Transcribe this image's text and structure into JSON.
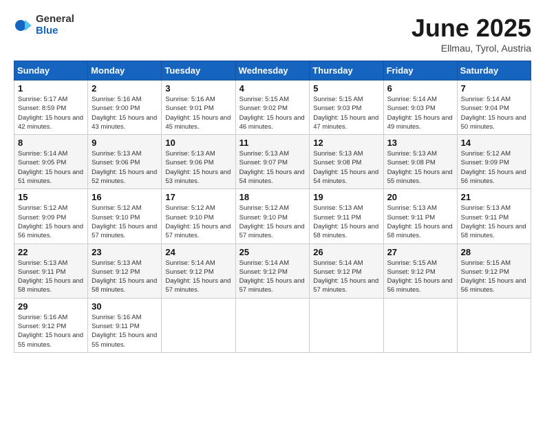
{
  "header": {
    "logo_text_general": "General",
    "logo_text_blue": "Blue",
    "month_title": "June 2025",
    "location": "Ellmau, Tyrol, Austria"
  },
  "calendar": {
    "headers": [
      "Sunday",
      "Monday",
      "Tuesday",
      "Wednesday",
      "Thursday",
      "Friday",
      "Saturday"
    ],
    "weeks": [
      [
        null,
        null,
        null,
        null,
        null,
        null,
        null
      ]
    ],
    "days": {
      "1": {
        "sunrise": "5:17 AM",
        "sunset": "8:59 PM",
        "daylight": "15 hours and 42 minutes."
      },
      "2": {
        "sunrise": "5:16 AM",
        "sunset": "9:00 PM",
        "daylight": "15 hours and 43 minutes."
      },
      "3": {
        "sunrise": "5:16 AM",
        "sunset": "9:01 PM",
        "daylight": "15 hours and 45 minutes."
      },
      "4": {
        "sunrise": "5:15 AM",
        "sunset": "9:02 PM",
        "daylight": "15 hours and 46 minutes."
      },
      "5": {
        "sunrise": "5:15 AM",
        "sunset": "9:03 PM",
        "daylight": "15 hours and 47 minutes."
      },
      "6": {
        "sunrise": "5:14 AM",
        "sunset": "9:03 PM",
        "daylight": "15 hours and 49 minutes."
      },
      "7": {
        "sunrise": "5:14 AM",
        "sunset": "9:04 PM",
        "daylight": "15 hours and 50 minutes."
      },
      "8": {
        "sunrise": "5:14 AM",
        "sunset": "9:05 PM",
        "daylight": "15 hours and 51 minutes."
      },
      "9": {
        "sunrise": "5:13 AM",
        "sunset": "9:06 PM",
        "daylight": "15 hours and 52 minutes."
      },
      "10": {
        "sunrise": "5:13 AM",
        "sunset": "9:06 PM",
        "daylight": "15 hours and 53 minutes."
      },
      "11": {
        "sunrise": "5:13 AM",
        "sunset": "9:07 PM",
        "daylight": "15 hours and 54 minutes."
      },
      "12": {
        "sunrise": "5:13 AM",
        "sunset": "9:08 PM",
        "daylight": "15 hours and 54 minutes."
      },
      "13": {
        "sunrise": "5:13 AM",
        "sunset": "9:08 PM",
        "daylight": "15 hours and 55 minutes."
      },
      "14": {
        "sunrise": "5:12 AM",
        "sunset": "9:09 PM",
        "daylight": "15 hours and 56 minutes."
      },
      "15": {
        "sunrise": "5:12 AM",
        "sunset": "9:09 PM",
        "daylight": "15 hours and 56 minutes."
      },
      "16": {
        "sunrise": "5:12 AM",
        "sunset": "9:10 PM",
        "daylight": "15 hours and 57 minutes."
      },
      "17": {
        "sunrise": "5:12 AM",
        "sunset": "9:10 PM",
        "daylight": "15 hours and 57 minutes."
      },
      "18": {
        "sunrise": "5:12 AM",
        "sunset": "9:10 PM",
        "daylight": "15 hours and 57 minutes."
      },
      "19": {
        "sunrise": "5:13 AM",
        "sunset": "9:11 PM",
        "daylight": "15 hours and 58 minutes."
      },
      "20": {
        "sunrise": "5:13 AM",
        "sunset": "9:11 PM",
        "daylight": "15 hours and 58 minutes."
      },
      "21": {
        "sunrise": "5:13 AM",
        "sunset": "9:11 PM",
        "daylight": "15 hours and 58 minutes."
      },
      "22": {
        "sunrise": "5:13 AM",
        "sunset": "9:11 PM",
        "daylight": "15 hours and 58 minutes."
      },
      "23": {
        "sunrise": "5:13 AM",
        "sunset": "9:12 PM",
        "daylight": "15 hours and 58 minutes."
      },
      "24": {
        "sunrise": "5:14 AM",
        "sunset": "9:12 PM",
        "daylight": "15 hours and 57 minutes."
      },
      "25": {
        "sunrise": "5:14 AM",
        "sunset": "9:12 PM",
        "daylight": "15 hours and 57 minutes."
      },
      "26": {
        "sunrise": "5:14 AM",
        "sunset": "9:12 PM",
        "daylight": "15 hours and 57 minutes."
      },
      "27": {
        "sunrise": "5:15 AM",
        "sunset": "9:12 PM",
        "daylight": "15 hours and 56 minutes."
      },
      "28": {
        "sunrise": "5:15 AM",
        "sunset": "9:12 PM",
        "daylight": "15 hours and 56 minutes."
      },
      "29": {
        "sunrise": "5:16 AM",
        "sunset": "9:12 PM",
        "daylight": "15 hours and 55 minutes."
      },
      "30": {
        "sunrise": "5:16 AM",
        "sunset": "9:11 PM",
        "daylight": "15 hours and 55 minutes."
      }
    }
  }
}
